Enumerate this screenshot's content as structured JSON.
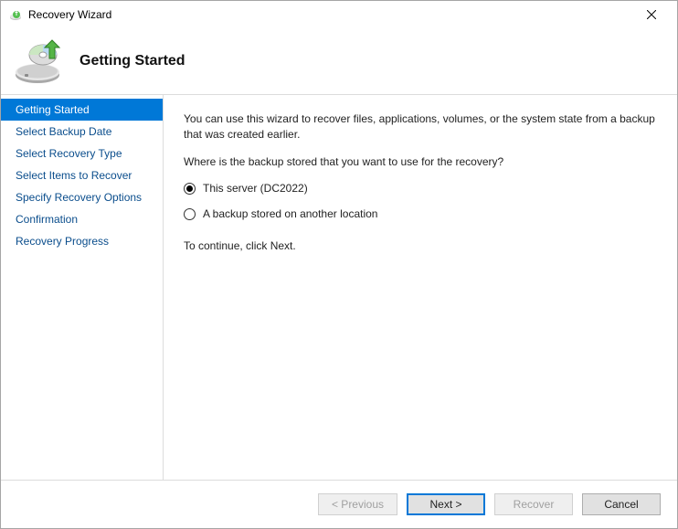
{
  "window": {
    "title": "Recovery Wizard"
  },
  "header": {
    "title": "Getting Started"
  },
  "nav": {
    "items": [
      {
        "label": "Getting Started",
        "active": true
      },
      {
        "label": "Select Backup Date",
        "active": false
      },
      {
        "label": "Select Recovery Type",
        "active": false
      },
      {
        "label": "Select Items to Recover",
        "active": false
      },
      {
        "label": "Specify Recovery Options",
        "active": false
      },
      {
        "label": "Confirmation",
        "active": false
      },
      {
        "label": "Recovery Progress",
        "active": false
      }
    ]
  },
  "content": {
    "intro": "You can use this wizard to recover files, applications, volumes, or the system state from a backup that was created earlier.",
    "question": "Where is the backup stored that you want to use for the recovery?",
    "options": {
      "this_server": {
        "label": "This server (DC2022)",
        "selected": true
      },
      "other_location": {
        "label": "A backup stored on another location",
        "selected": false
      }
    },
    "continue_hint": "To continue, click Next."
  },
  "footer": {
    "previous": "< Previous",
    "next": "Next >",
    "recover": "Recover",
    "cancel": "Cancel"
  }
}
